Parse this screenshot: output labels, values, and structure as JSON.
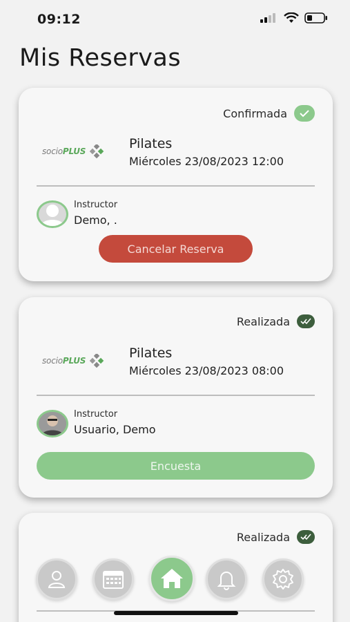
{
  "status_bar": {
    "time": "09:12"
  },
  "page_title": "Mis Reservas",
  "reservations": [
    {
      "status": "Confirmada",
      "logo": {
        "prefix": "socio",
        "brand": "PLUS"
      },
      "class_name": "Pilates",
      "date": "Miércoles 23/08/2023 12:00",
      "instructor_label": "Instructor",
      "instructor_name": "Demo, .",
      "action": "Cancelar Reserva"
    },
    {
      "status": "Realizada",
      "logo": {
        "prefix": "socio",
        "brand": "PLUS"
      },
      "class_name": "Pilates",
      "date": "Miércoles 23/08/2023 08:00",
      "instructor_label": "Instructor",
      "instructor_name": "Usuario, Demo",
      "action": "Encuesta"
    },
    {
      "status": "Realizada"
    }
  ],
  "nav": [
    {
      "icon": "user-icon"
    },
    {
      "icon": "calendar-icon"
    },
    {
      "icon": "home-icon",
      "active": true
    },
    {
      "icon": "bell-icon"
    },
    {
      "icon": "gear-icon"
    }
  ],
  "colors": {
    "accent": "#8cc98c",
    "cancel": "#c44a3c",
    "done_check": "#3d5e3d"
  }
}
